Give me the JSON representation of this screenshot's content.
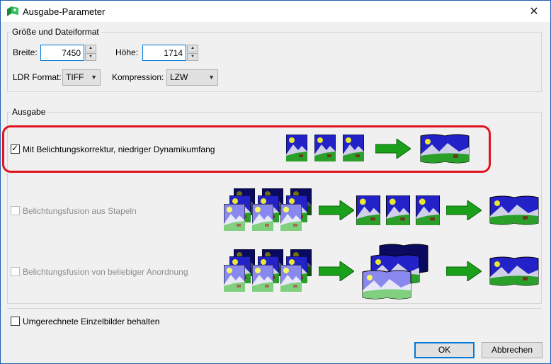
{
  "window": {
    "title": "Ausgabe-Parameter"
  },
  "size_group": {
    "legend": "Größe und Dateiformat",
    "width_label": "Breite:",
    "width_value": "7450",
    "height_label": "Höhe:",
    "height_value": "1714",
    "ldr_format_label": "LDR Format:",
    "ldr_format_value": "TIFF",
    "compression_label": "Kompression:",
    "compression_value": "LZW"
  },
  "output_group": {
    "legend": "Ausgabe",
    "options": [
      {
        "label": "Mit Belichtungskorrektur, niedriger Dynamikumfang",
        "checked": true,
        "enabled": true
      },
      {
        "label": "Belichtungsfusion aus Stapeln",
        "checked": false,
        "enabled": false
      },
      {
        "label": "Belichtungsfusion von beliebiger Anordnung",
        "checked": false,
        "enabled": false
      }
    ]
  },
  "keep_images": {
    "label": "Umgerechnete Einzelbilder behalten",
    "checked": false
  },
  "buttons": {
    "ok": "OK",
    "cancel": "Abbrechen"
  },
  "colors": {
    "accent": "#0078d7",
    "highlight": "#e0141e",
    "arrow": "#1aa01a"
  }
}
